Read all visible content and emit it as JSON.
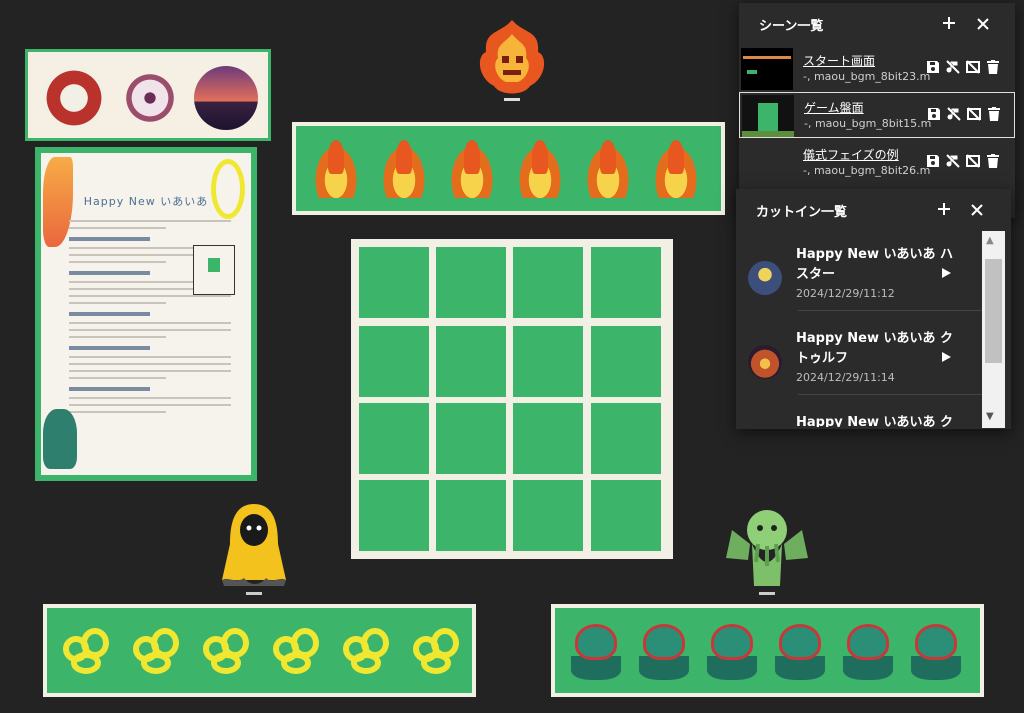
{
  "scene_panel": {
    "title": "シーン一覧",
    "add_icon": "plus-icon",
    "close_icon": "close-icon",
    "scenes": [
      {
        "name": "スタート画面",
        "meta": "-, maou_bgm_8bit23.m..."
      },
      {
        "name": "ゲーム盤面",
        "meta": "-, maou_bgm_8bit15.m..."
      },
      {
        "name": "儀式フェイズの例",
        "meta": "-, maou_bgm_8bit26.m..."
      }
    ]
  },
  "cutin_panel": {
    "title": "カットイン一覧",
    "items": [
      {
        "name": "Happy New いあいあ ハスター",
        "date": "2024/12/29/11:12"
      },
      {
        "name": "Happy New いあいあ クトゥルフ",
        "date": "2024/12/29/11:14"
      },
      {
        "name": "Happy New いあいあ クト",
        "date": ""
      }
    ]
  },
  "document": {
    "title": "Happy New いあいあ"
  },
  "colors": {
    "background": "#232323",
    "card_green": "#3cb46a",
    "card_border": "#f2efe4",
    "panel_bg": "#2b2b2b"
  }
}
